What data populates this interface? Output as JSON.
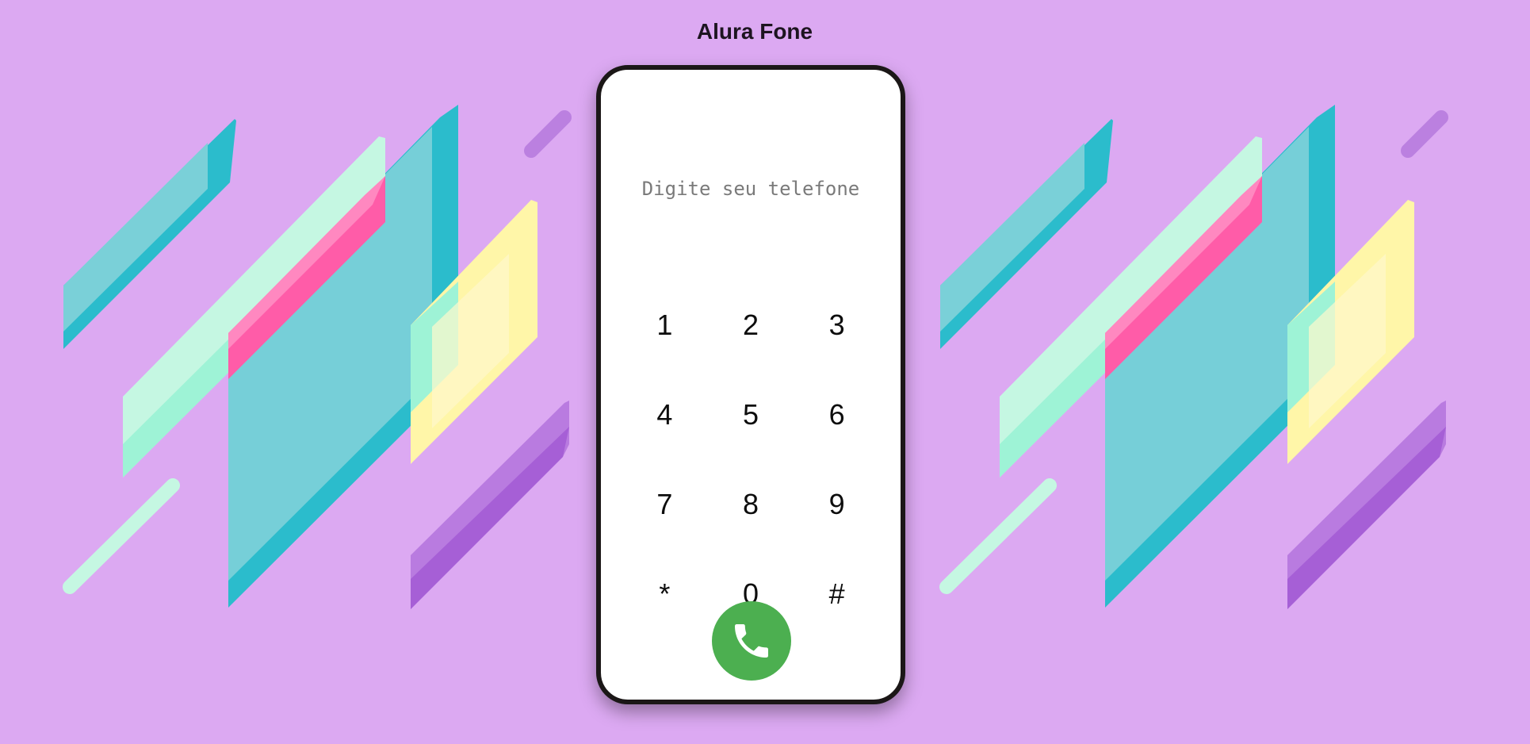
{
  "app": {
    "title": "Alura Fone"
  },
  "phone": {
    "input": {
      "placeholder": "Digite seu telefone",
      "value": ""
    },
    "keys": [
      "1",
      "2",
      "3",
      "4",
      "5",
      "6",
      "7",
      "8",
      "9",
      "*",
      "0",
      "#"
    ],
    "call_icon": "phone-handset-icon"
  },
  "colors": {
    "background": "#dca9f2",
    "phone_frame": "#1b1717",
    "call_button": "#4caf50",
    "teal": "#2bbccc",
    "mint": "#c3f7e1",
    "pink": "#ff5ca8",
    "yellow": "#fff5a6",
    "purple": "#b06ad9"
  }
}
